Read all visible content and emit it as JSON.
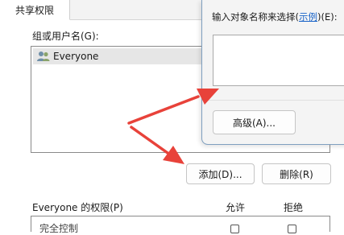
{
  "tab": {
    "label": "共享权限"
  },
  "panel": {
    "group_label": "组或用户名(G):",
    "users": [
      {
        "name": "Everyone"
      }
    ],
    "add_button": "添加(D)...",
    "remove_button": "删除(R)",
    "permissions_label": "Everyone 的权限(P)",
    "allow_label": "允许",
    "deny_label": "拒绝",
    "first_permission": "完全控制"
  },
  "dialog": {
    "prompt_before": "输入对象名称来选择(",
    "prompt_link": "示例",
    "prompt_after": ")(E):",
    "advanced_button": "高级(A)..."
  },
  "colors": {
    "arrow": "#e8423a",
    "link": "#1a64c8"
  },
  "icons": {
    "user": "users-group-icon",
    "arrow": "red-arrow-icon"
  }
}
